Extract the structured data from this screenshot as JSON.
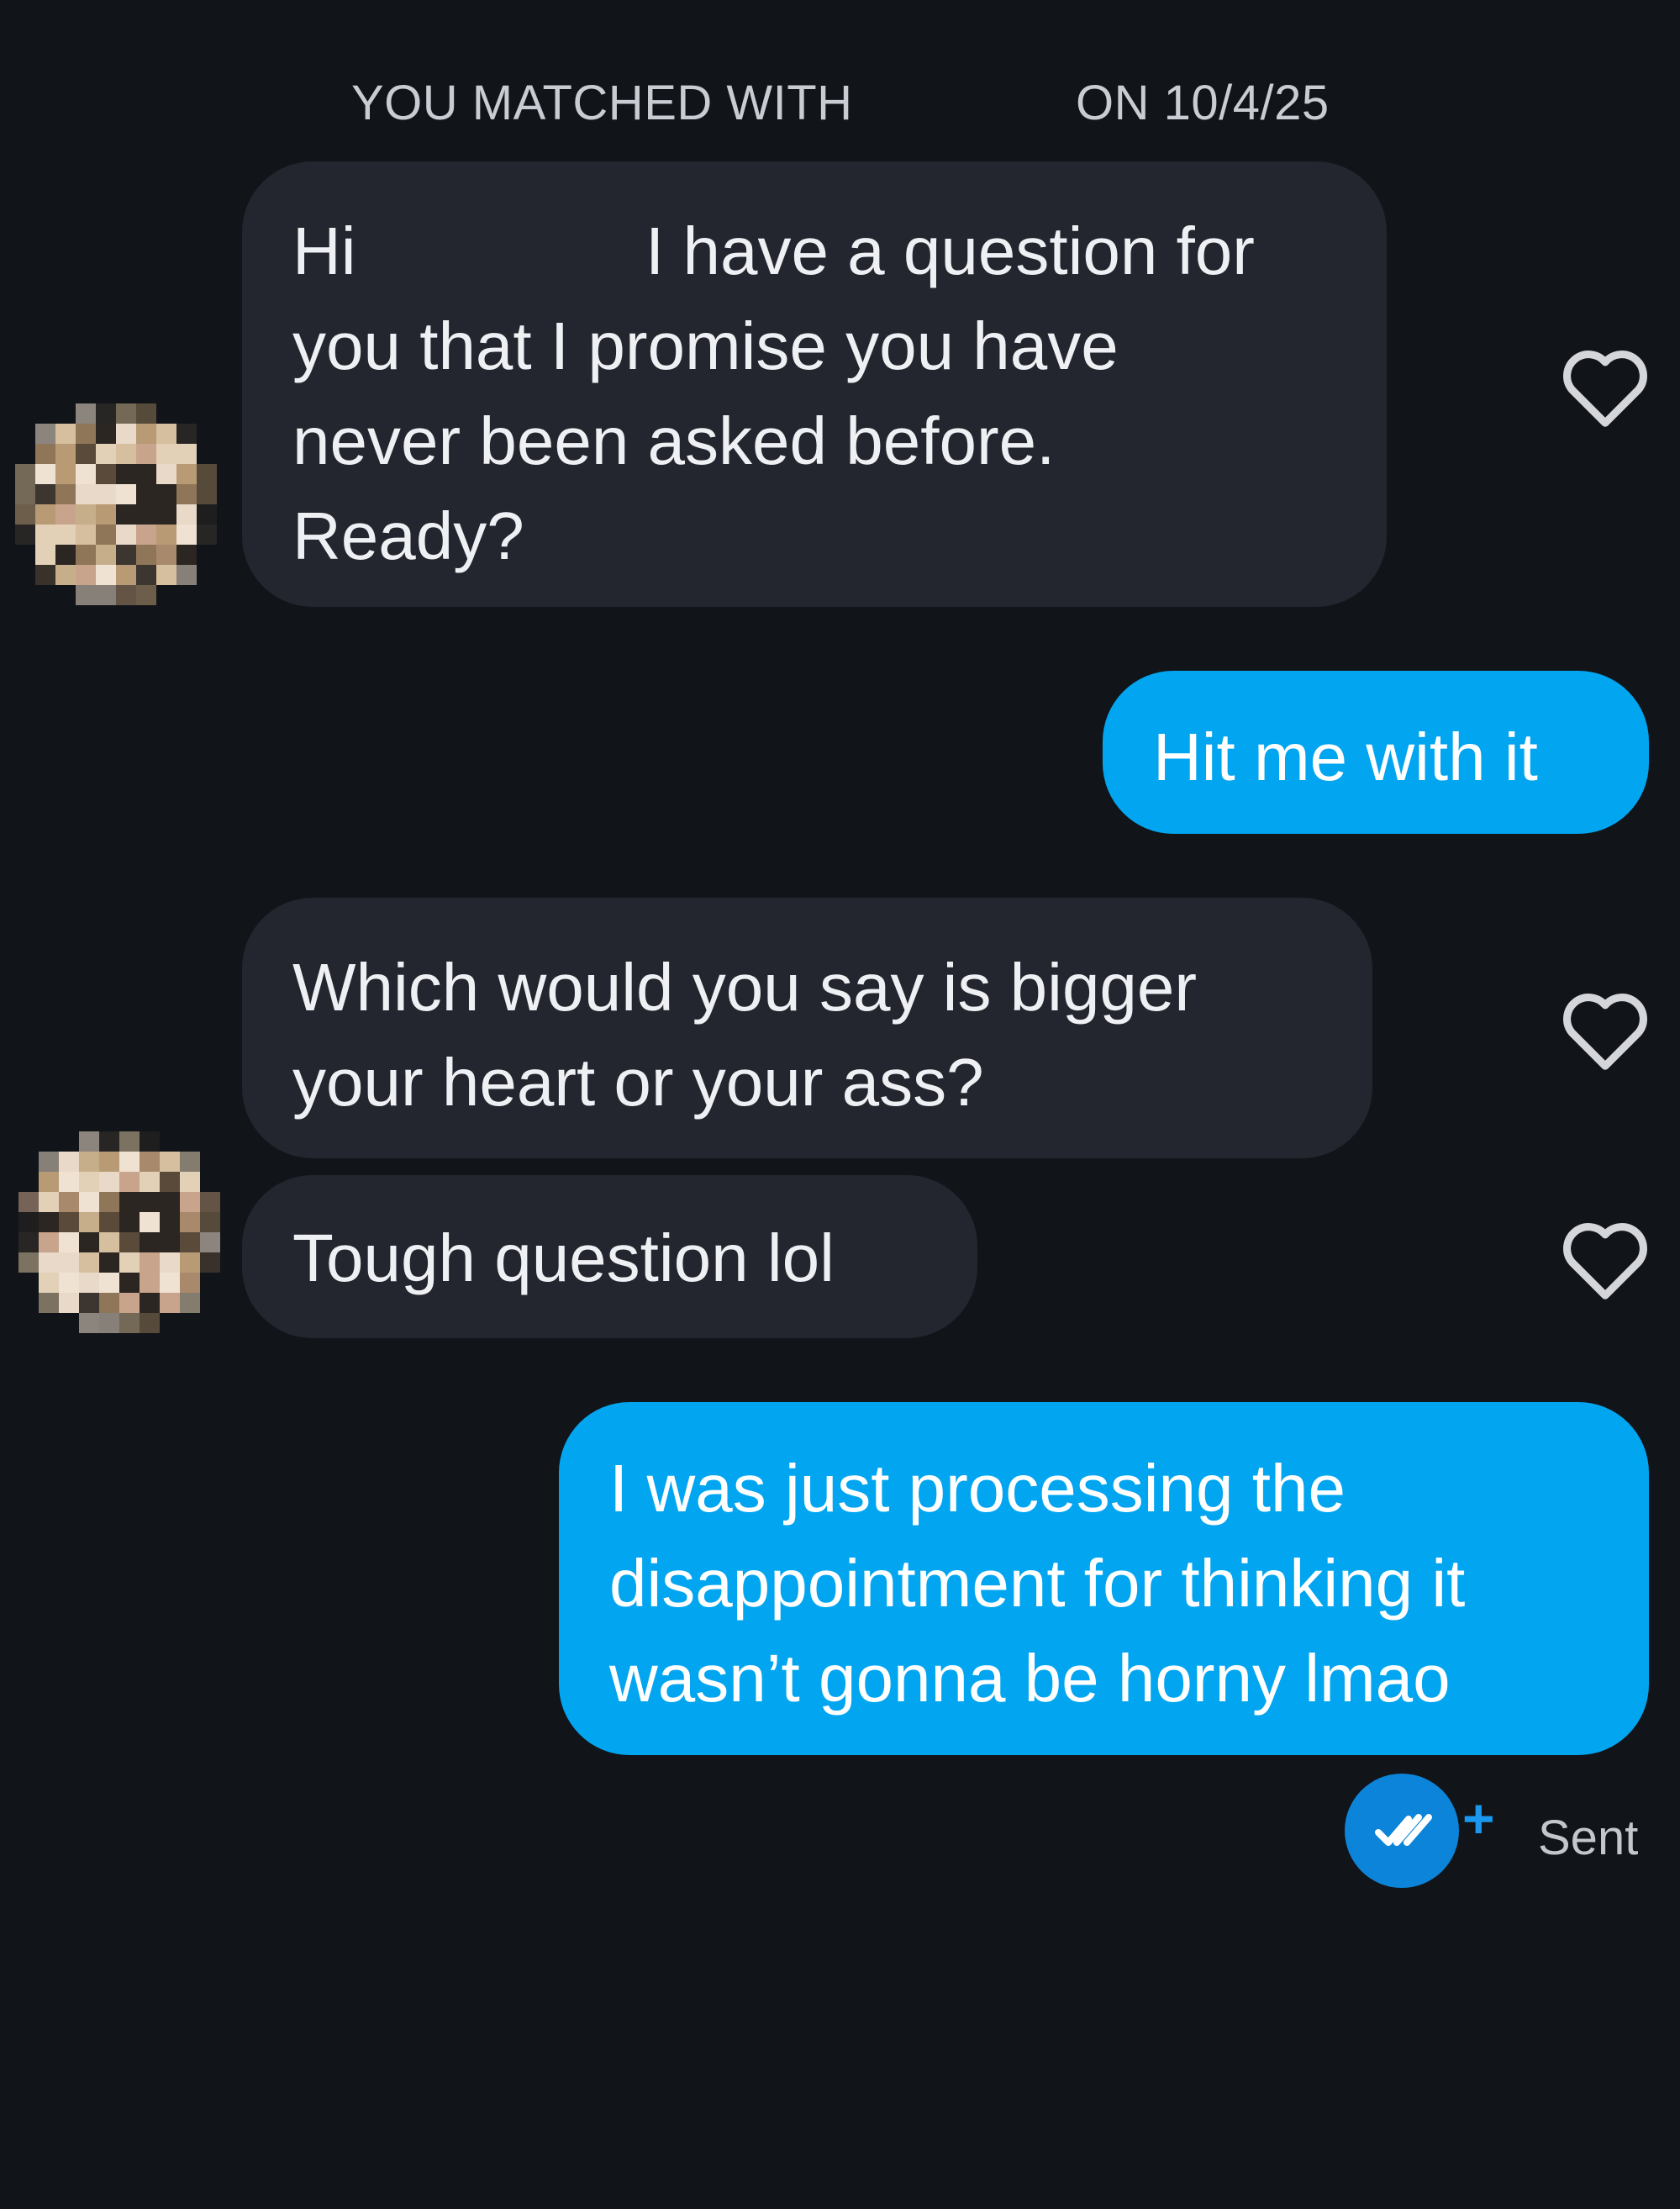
{
  "header": {
    "matched_prefix": "YOU MATCHED WITH",
    "matched_date": "ON 10/4/25"
  },
  "messages": [
    {
      "direction": "incoming",
      "text_before_redaction": "Hi",
      "text_after_redaction": "I have a question for\nyou that I promise you have\nnever been asked before.\nReady?"
    },
    {
      "direction": "outgoing",
      "text": "Hit me with it"
    },
    {
      "direction": "incoming",
      "text": "Which would you say is bigger\nyour heart or your ass?"
    },
    {
      "direction": "incoming",
      "text": "Tough question lol"
    },
    {
      "direction": "outgoing",
      "text": "I was just processing the\ndisappointment for thinking it\nwasn’t gonna be horny lmao"
    }
  ],
  "status": {
    "receipt_icon": "double-check-icon",
    "plus_label": "+",
    "sent_label": "Sent"
  },
  "colors": {
    "background": "#111419",
    "incoming_bubble": "#23262e",
    "outgoing_bubble": "#02a5f0",
    "receipt": "#0c84d9"
  }
}
